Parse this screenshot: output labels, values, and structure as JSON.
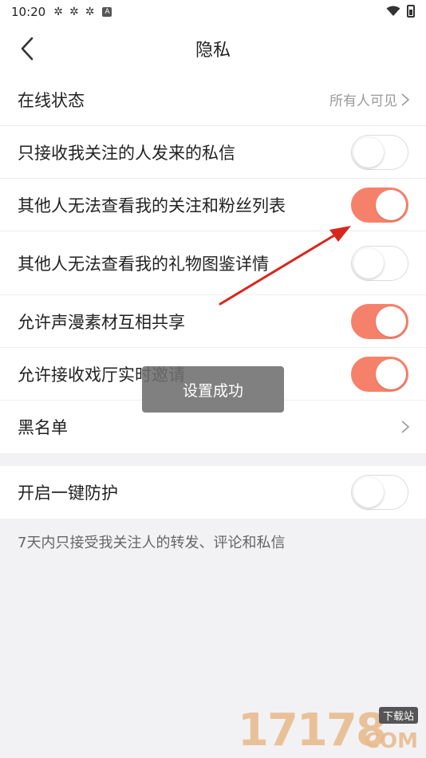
{
  "status_bar": {
    "time": "10:20",
    "badge": "A"
  },
  "header": {
    "title": "隐私"
  },
  "online_status": {
    "label": "在线状态",
    "value": "所有人可见"
  },
  "settings": [
    {
      "label": "只接收我关注的人发来的私信",
      "on": false
    },
    {
      "label": "其他人无法查看我的关注和粉丝列表",
      "on": true
    },
    {
      "label": "其他人无法查看我的礼物图鉴详情",
      "on": false
    },
    {
      "label": "允许声漫素材互相共享",
      "on": true
    },
    {
      "label": "允许接收戏厅实时邀请",
      "on": true
    }
  ],
  "blacklist": {
    "label": "黑名单"
  },
  "protection": {
    "label": "开启一键防护",
    "on": false,
    "note": "7天内只接受我关注人的转发、评论和私信"
  },
  "toast": {
    "text": "设置成功"
  },
  "watermark": {
    "number": "17178",
    "tag": "下载站",
    "suffix": "COM"
  },
  "colors": {
    "accent": "#f6816a",
    "arrow": "#d9261c",
    "background": "#f2f2f4"
  }
}
